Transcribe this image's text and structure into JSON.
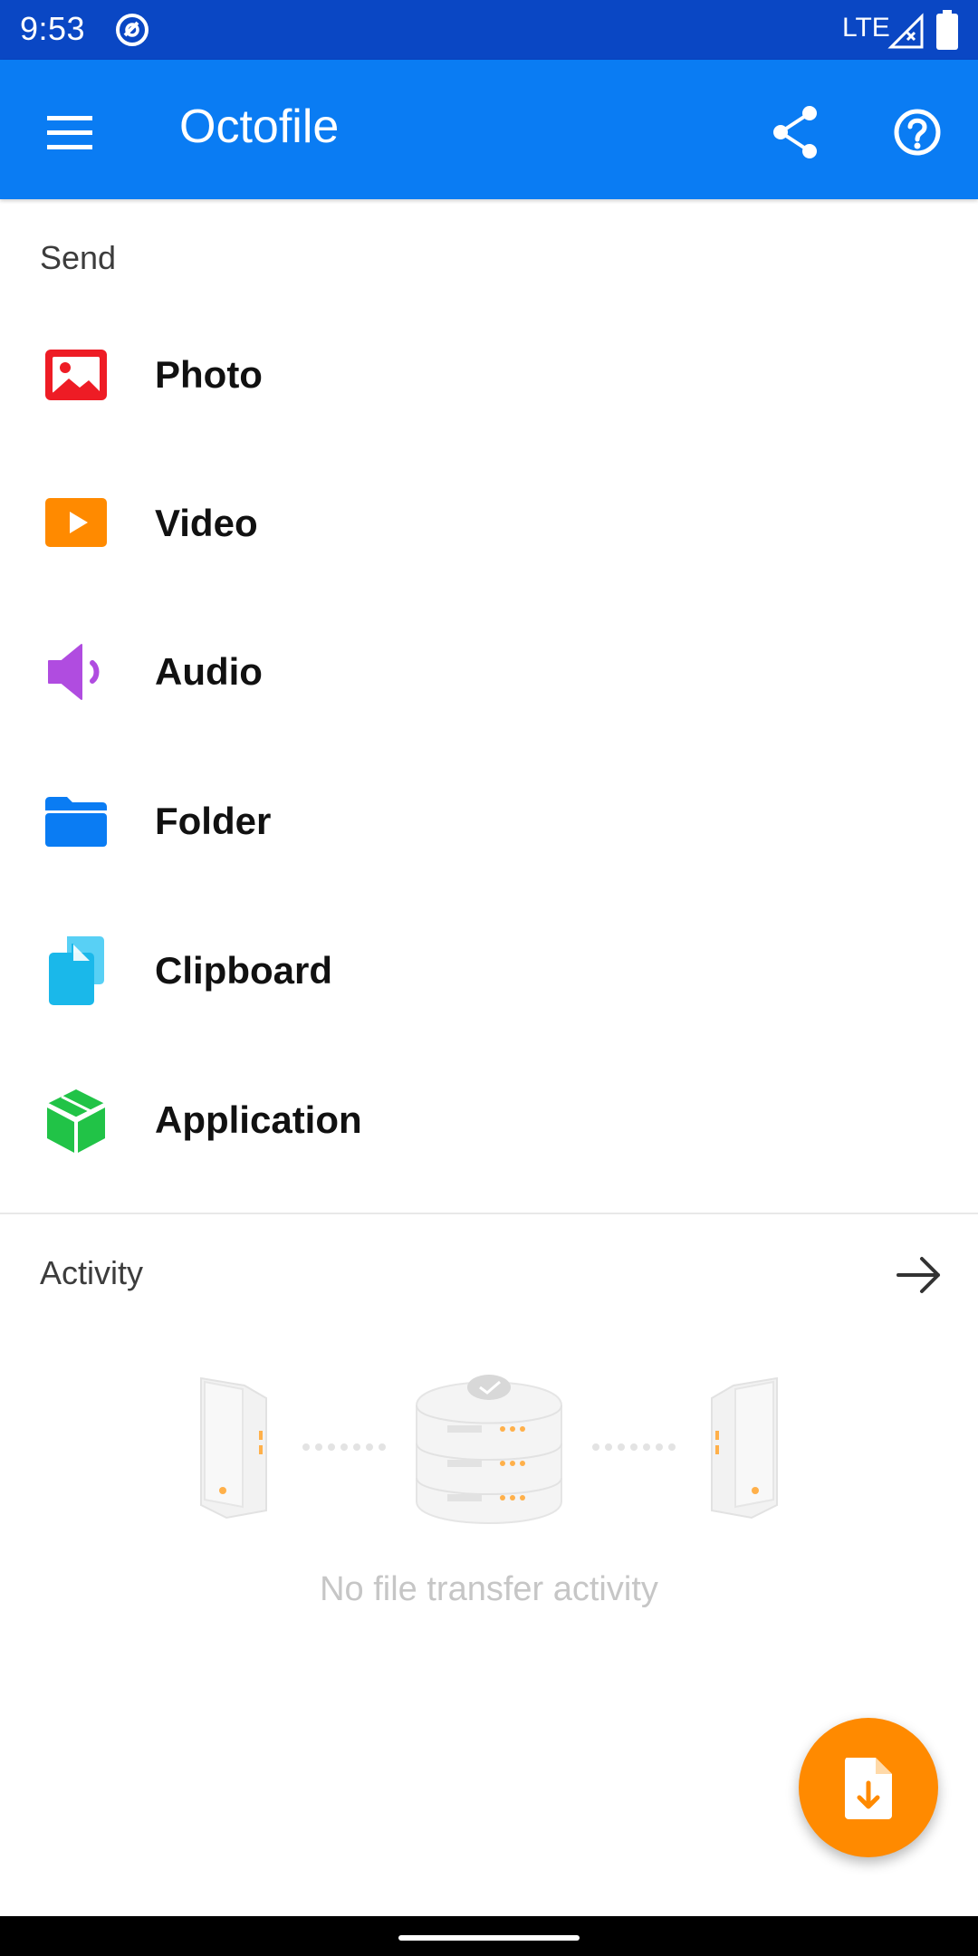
{
  "status_bar": {
    "time": "9:53",
    "network": "LTE"
  },
  "app_bar": {
    "title": "Octofile"
  },
  "send": {
    "label": "Send",
    "items": [
      {
        "label": "Photo",
        "icon": "photo-icon",
        "color": "#ee1c25"
      },
      {
        "label": "Video",
        "icon": "video-play-icon",
        "color": "#ff8a00"
      },
      {
        "label": "Audio",
        "icon": "speaker-icon",
        "color": "#b04ce0"
      },
      {
        "label": "Folder",
        "icon": "folder-icon",
        "color": "#0a7cf3"
      },
      {
        "label": "Clipboard",
        "icon": "clipboard-icon",
        "color": "#1ab8ea"
      },
      {
        "label": "Application",
        "icon": "package-icon",
        "color": "#21c347"
      }
    ]
  },
  "activity": {
    "label": "Activity",
    "empty_text": "No file transfer activity"
  },
  "colors": {
    "status_bar": "#0a47c4",
    "app_bar": "#0a7cf3",
    "fab": "#ff8a00"
  }
}
